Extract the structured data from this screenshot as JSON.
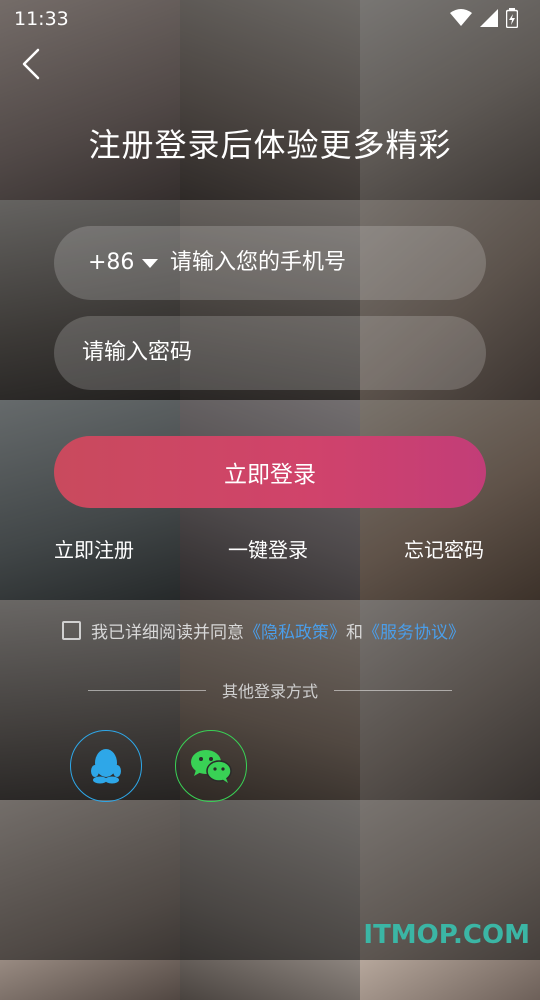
{
  "status_bar": {
    "time": "11:33"
  },
  "header": {
    "title": "注册登录后体验更多精彩"
  },
  "phone_field": {
    "country_code": "+86",
    "placeholder": "请输入您的手机号"
  },
  "password_field": {
    "placeholder": "请输入密码"
  },
  "login_button": {
    "label": "立即登录"
  },
  "links": {
    "register": "立即注册",
    "one_click": "一键登录",
    "forgot": "忘记密码"
  },
  "agreement": {
    "prefix": "我已详细阅读并同意",
    "privacy": "《隐私政策》",
    "and": "和",
    "service": "《服务协议》"
  },
  "other_login": {
    "label": "其他登录方式"
  },
  "social": [
    {
      "name": "qq-icon"
    },
    {
      "name": "wechat-icon"
    }
  ],
  "watermark": {
    "text": "ITMOP.COM"
  },
  "colors": {
    "accent_start": "#c94a5d",
    "accent_end": "#c23d78",
    "link": "#4a9eea",
    "qq": "#2ea7e8",
    "wechat": "#39d155"
  }
}
